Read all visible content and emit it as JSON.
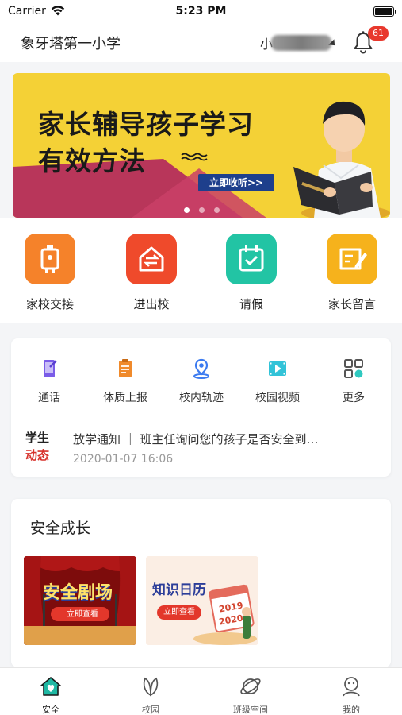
{
  "status_bar": {
    "carrier": "Carrier",
    "time": "5:23 PM"
  },
  "header": {
    "school_name": "象牙塔第一小学",
    "user_name_visible": "小",
    "notification_count": "61"
  },
  "banner": {
    "title_line1": "家长辅导孩子学习",
    "title_line2": "有效方法",
    "cta": "立即收听>>",
    "slide_count": 3,
    "active_slide": 1
  },
  "quick_actions": [
    {
      "label": "家校交接",
      "icon": "handover-icon",
      "color": "#f5822a"
    },
    {
      "label": "进出校",
      "icon": "entry-exit-icon",
      "color": "#ef4a2b"
    },
    {
      "label": "请假",
      "icon": "leave-calendar-icon",
      "color": "#22c4a4"
    },
    {
      "label": "家长留言",
      "icon": "message-pen-icon",
      "color": "#f6b21c"
    }
  ],
  "services": [
    {
      "label": "通话",
      "icon": "phone-icon"
    },
    {
      "label": "体质上报",
      "icon": "health-report-icon"
    },
    {
      "label": "校内轨迹",
      "icon": "location-icon"
    },
    {
      "label": "校园视频",
      "icon": "video-icon"
    },
    {
      "label": "更多",
      "icon": "more-grid-icon"
    }
  ],
  "news": {
    "tag_line1": "学生",
    "tag_line2": "动态",
    "text": "放学通知 ｜ 班主任询问您的孩子是否安全到…",
    "time": "2020-01-07 16:06"
  },
  "growth": {
    "title": "安全成长",
    "cards": [
      {
        "title": "安全剧场",
        "button": "立即查看"
      },
      {
        "title": "知识日历",
        "button": "立即查看",
        "year1": "2019",
        "year2": "2020"
      }
    ]
  },
  "tabs": [
    {
      "label": "安全",
      "active": true
    },
    {
      "label": "校园",
      "active": false
    },
    {
      "label": "班级空间",
      "active": false
    },
    {
      "label": "我的",
      "active": false
    }
  ]
}
